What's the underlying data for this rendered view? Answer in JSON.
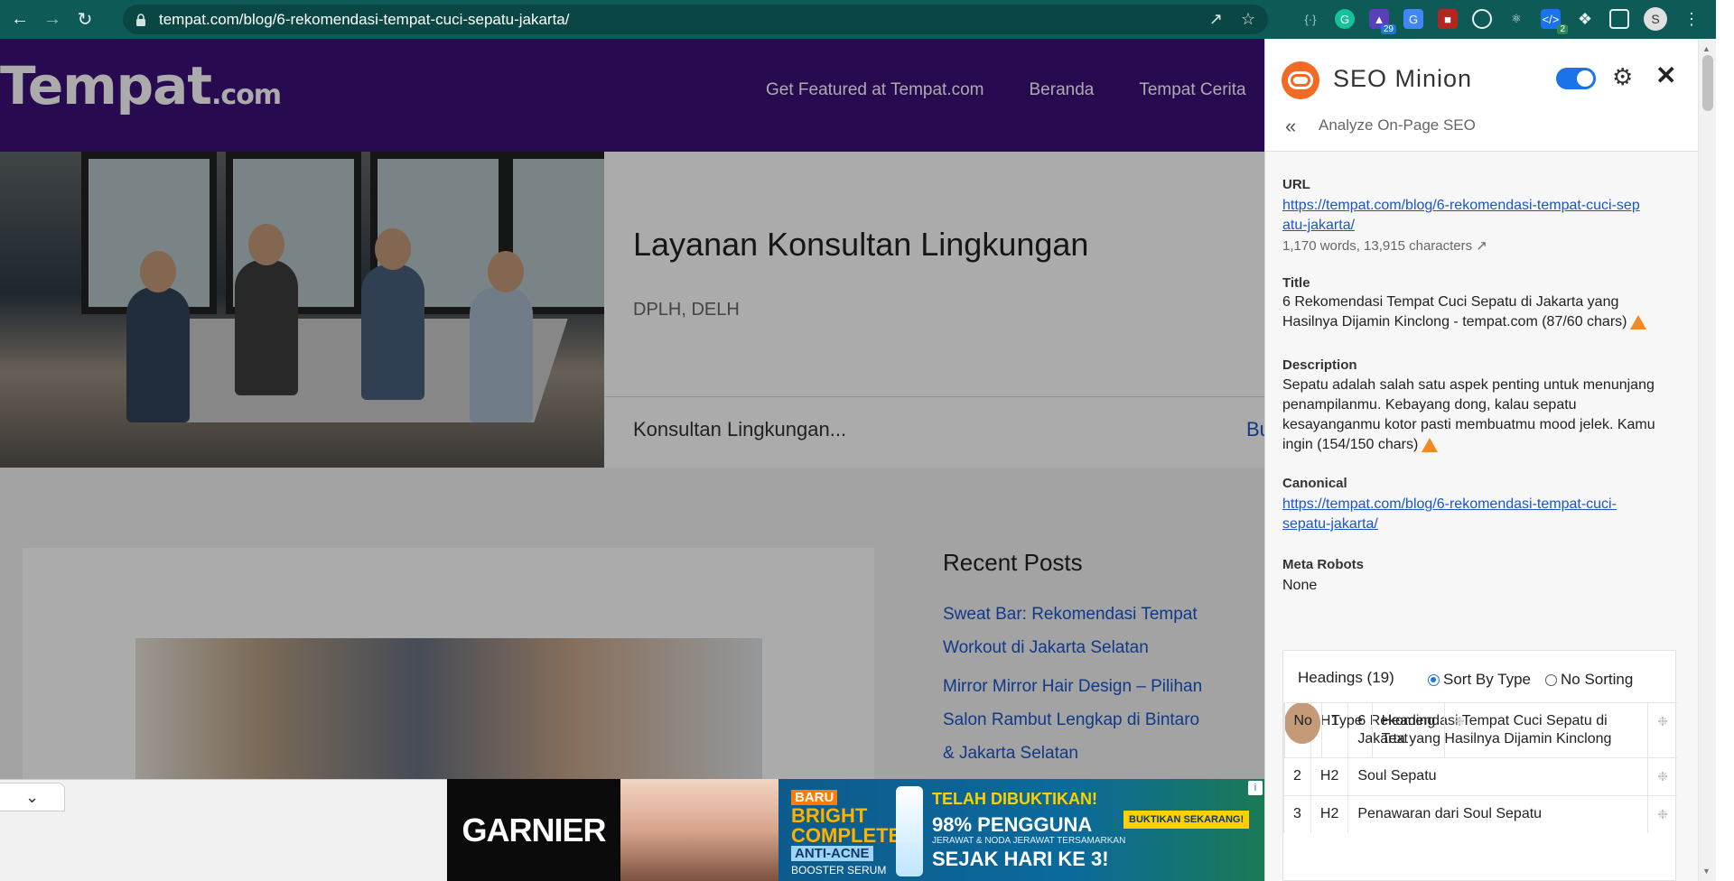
{
  "browser": {
    "url": "tempat.com/blog/6-rekomendasi-tempat-cuci-sepatu-jakarta/",
    "extension_badge_count": "29",
    "extension_badge_small": "2",
    "profile_initial": "S"
  },
  "site": {
    "logo_main": "Tempat",
    "logo_suffix": ".com",
    "nav": [
      {
        "label": "Get Featured at Tempat.com"
      },
      {
        "label": "Beranda"
      },
      {
        "label": "Tempat Cerita"
      }
    ],
    "hero": {
      "title": "Layanan Konsultan Lingkungan",
      "subtitle": "DPLH, DELH",
      "footer_text": "Konsultan Lingkungan...",
      "link_text": "Bu"
    },
    "recent_posts": {
      "title": "Recent Posts",
      "items": [
        {
          "line1": "Sweat Bar: Rekomendasi Tempat",
          "line2": "Workout di Jakarta Selatan"
        },
        {
          "line1": "Mirror Mirror Hair Design – Pilihan",
          "line2": "Salon Rambut Lengkap di Bintaro",
          "line3": "& Jakarta Selatan"
        }
      ]
    },
    "ad": {
      "brand": "GARNIER",
      "badge": "BARU",
      "product_line1": "BRIGHT",
      "product_line2": "COMPLETE",
      "product_variant": "ANTI-ACNE",
      "product_type": "BOOSTER SERUM",
      "headline1": "TELAH DIBUKTIKAN!",
      "headline2": "98% PENGGUNA",
      "headline3": "JERAWAT & NODA JERAWAT TERSAMARKAN",
      "headline4": "SEJAK HARI KE 3!",
      "cta": "BUKTIKAN SEKARANG!"
    }
  },
  "seo_panel": {
    "title": "SEO Minion",
    "toggle_on": true,
    "back_label": "Analyze On-Page SEO",
    "url_label": "URL",
    "url_line1": "https://tempat.com/blog/6-rekomendasi-tempat-cuci-sep",
    "url_line2": "atu-jakarta/",
    "word_stats": "1,170 words, 13,915 characters",
    "title_label": "Title",
    "title_line1": "6 Rekomendasi Tempat Cuci Sepatu di Jakarta yang",
    "title_line2": "Hasilnya Dijamin Kinclong - tempat.com (87/60 chars)",
    "desc_label": "Description",
    "desc_line1": "Sepatu adalah salah satu aspek penting untuk menunjang",
    "desc_line2": "penampilanmu. Kebayang dong, kalau sepatu",
    "desc_line3": "kesayanganmu kotor pasti membuatmu mood jelek. Kamu",
    "desc_line4": "ingin (154/150 chars)",
    "canonical_label": "Canonical",
    "canonical_line1": "https://tempat.com/blog/6-rekomendasi-tempat-cuci-",
    "canonical_line2": "sepatu-jakarta/",
    "robots_label": "Meta Robots",
    "robots_value": "None",
    "headings": {
      "title": "Headings (19)",
      "sort_by_type": "Sort By Type",
      "no_sorting": "No Sorting",
      "columns": {
        "no": "No",
        "type": "Type",
        "text": "Heading Text"
      },
      "rows": [
        {
          "no": "1",
          "type": "H1",
          "text": "6 Rekomendasi Tempat Cuci Sepatu di Jakarta yang Hasilnya Dijamin Kinclong"
        },
        {
          "no": "2",
          "type": "H2",
          "text": "Soul Sepatu"
        },
        {
          "no": "3",
          "type": "H2",
          "text": "Penawaran dari Soul Sepatu"
        }
      ]
    }
  }
}
